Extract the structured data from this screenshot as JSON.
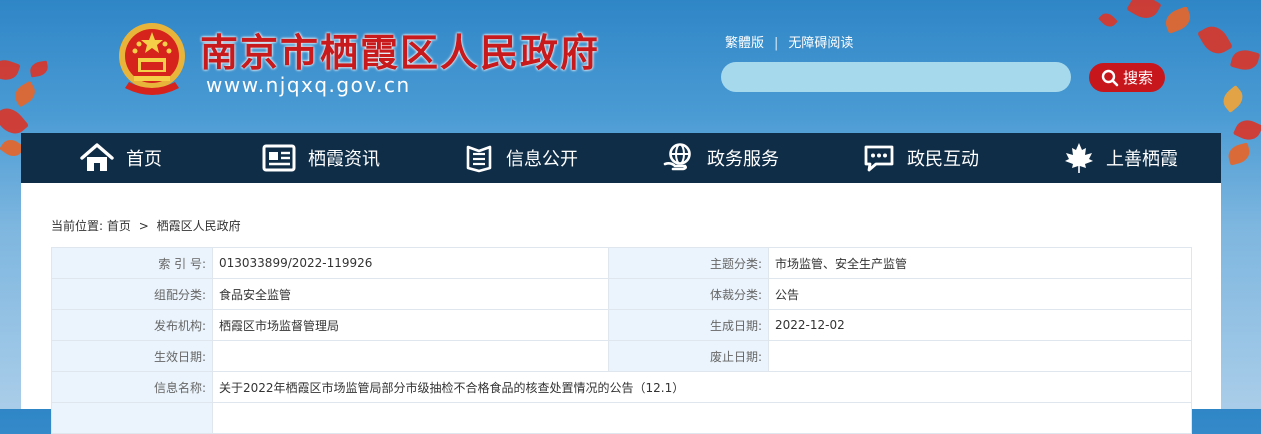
{
  "header": {
    "site_title": "南京市栖霞区人民政府",
    "site_url": "www.njqxq.gov.cn",
    "emblem_icon": "national-emblem-icon",
    "links": {
      "traditional": "繁體版",
      "separator": "|",
      "accessible": "无障碍阅读"
    },
    "search": {
      "placeholder": "",
      "button_label": "搜索",
      "button_color": "#c8161d"
    }
  },
  "nav": {
    "background": "#0f2d47",
    "items": [
      {
        "label": "首页",
        "icon": "home-icon"
      },
      {
        "label": "栖霞资讯",
        "icon": "news-icon"
      },
      {
        "label": "信息公开",
        "icon": "book-icon"
      },
      {
        "label": "政务服务",
        "icon": "globe-hand-icon"
      },
      {
        "label": "政民互动",
        "icon": "chat-icon"
      },
      {
        "label": "上善栖霞",
        "icon": "maple-leaf-icon"
      }
    ]
  },
  "breadcrumb": {
    "prefix": "当前位置:",
    "items": [
      "首页",
      "栖霞区人民政府"
    ],
    "separator": ">"
  },
  "meta": {
    "index_label": "索 引 号:",
    "index_value": "013033899/2022-119926",
    "topic_label": "主题分类:",
    "topic_value": "市场监管、安全生产监管",
    "category_label": "组配分类:",
    "category_value": "食品安全监管",
    "genre_label": "体裁分类:",
    "genre_value": "公告",
    "publisher_label": "发布机构:",
    "publisher_value": "栖霞区市场监督管理局",
    "created_label": "生成日期:",
    "created_value": "2022-12-02",
    "effective_label": "生效日期:",
    "effective_value": "",
    "abolished_label": "废止日期:",
    "abolished_value": "",
    "name_label": "信息名称:",
    "name_value": "关于2022年栖霞区市场监管局部分市级抽检不合格食品的核查处置情况的公告（12.1）"
  }
}
